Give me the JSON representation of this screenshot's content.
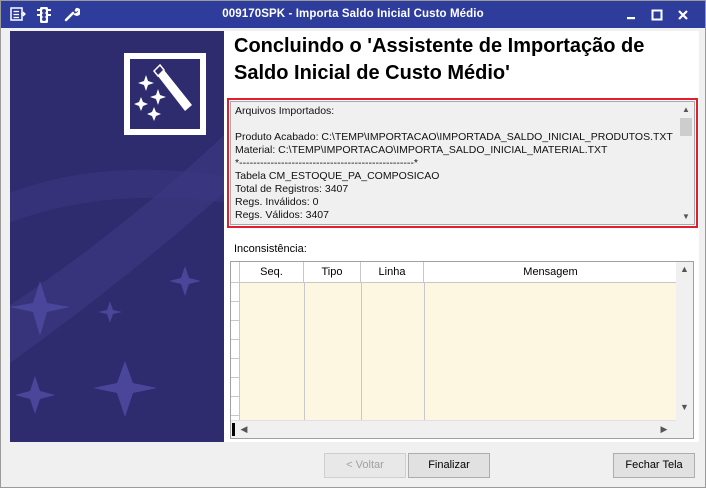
{
  "window": {
    "title": "009170SPK - Importa Saldo Inicial Custo Médio",
    "icons": [
      "export-icon",
      "traffic-light-icon",
      "wrench-icon"
    ],
    "controls": {
      "minimize": "–",
      "maximize": "□",
      "close": "✕"
    }
  },
  "heading": "Concluindo o 'Assistente de Importação de Saldo Inicial de Custo Médio'",
  "log": {
    "lines": [
      "Arquivos Importados:",
      "",
      "Produto Acabado: C:\\TEMP\\IMPORTACAO\\IMPORTADA_SALDO_INICIAL_PRODUTOS.TXT",
      "Material: C:\\TEMP\\IMPORTACAO\\IMPORTA_SALDO_INICIAL_MATERIAL.TXT",
      "*--------------------------------------------------*",
      "Tabela CM_ESTOQUE_PA_COMPOSICAO",
      "Total de Registros: 3407",
      "Regs. Inválidos: 0",
      "Regs. Válidos: 3407"
    ]
  },
  "inconsistencias": {
    "label": "Inconsistência:",
    "columns": [
      "Seq.",
      "Tipo",
      "Linha",
      "Mensagem"
    ],
    "rows": []
  },
  "buttons": {
    "voltar": "< Voltar",
    "finalizar": "Finalizar",
    "fechar": "Fechar Tela"
  },
  "colors": {
    "titlebar": "#2e3d9b",
    "banner": "#2e2b6e",
    "highlight_border": "#e01e2e",
    "grid_body": "#fdf7e1"
  }
}
